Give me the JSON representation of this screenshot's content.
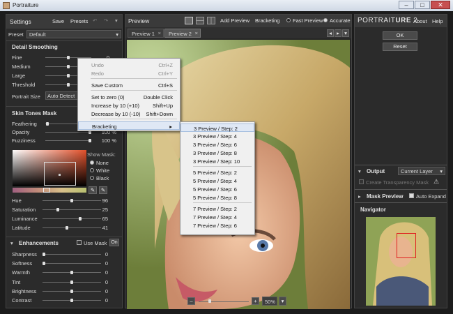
{
  "window": {
    "title": "Portraiture",
    "minimize": "–",
    "maximize": "□",
    "close": "✕"
  },
  "settings": {
    "title": "Settings",
    "save": "Save",
    "presets": "Presets",
    "preset_label": "Preset",
    "preset_value": "Default"
  },
  "detail": {
    "title": "Detail Smoothing",
    "items": [
      {
        "label": "Fine",
        "value": "0",
        "pos": 0.5
      },
      {
        "label": "Medium",
        "value": "",
        "pos": 0.5
      },
      {
        "label": "Large",
        "value": "",
        "pos": 0.5
      },
      {
        "label": "Threshold",
        "value": "",
        "pos": 0.5
      }
    ],
    "portrait_size_label": "Portrait Size",
    "portrait_size_value": "Auto Detect"
  },
  "skin": {
    "title": "Skin Tones Mask",
    "items": [
      {
        "label": "Feathering",
        "value": "",
        "pos": 0.02
      },
      {
        "label": "Opacity",
        "value": "100 %",
        "pos": 1
      },
      {
        "label": "Fuzziness",
        "value": "100 %",
        "pos": 1
      }
    ],
    "show_mask_label": "Show Mask:",
    "radios": [
      "None",
      "White",
      "Black"
    ],
    "hsl": [
      {
        "label": "Hue",
        "value": "96",
        "pos": 0.5
      },
      {
        "label": "Saturation",
        "value": "25",
        "pos": 0.25
      },
      {
        "label": "Luminance",
        "value": "65",
        "pos": 0.65
      },
      {
        "label": "Latitude",
        "value": "41",
        "pos": 0.41
      }
    ]
  },
  "enh": {
    "title": "Enhancements",
    "use_mask": "Use Mask",
    "on": "On",
    "items": [
      {
        "label": "Sharpness",
        "value": "0",
        "pos": 0
      },
      {
        "label": "Softness",
        "value": "0",
        "pos": 0
      },
      {
        "label": "Warmth",
        "value": "0",
        "pos": 0.5
      },
      {
        "label": "Tint",
        "value": "0",
        "pos": 0.5
      },
      {
        "label": "Brightness",
        "value": "0",
        "pos": 0.5
      },
      {
        "label": "Contrast",
        "value": "0",
        "pos": 0.5
      }
    ]
  },
  "preview": {
    "title": "Preview",
    "add_preview": "Add Preview",
    "bracketing": "Bracketing",
    "fast": "Fast Preview",
    "accurate": "Accurate",
    "tabs": [
      {
        "label": "Preview 1"
      },
      {
        "label": "Preview 2"
      }
    ],
    "zoom": "50%",
    "zoom_pos": 0.2,
    "minus": "–",
    "plus": "+"
  },
  "context_menu": {
    "items": [
      {
        "label": "Undo",
        "key": "Ctrl+Z",
        "disabled": true
      },
      {
        "label": "Redo",
        "key": "Ctrl+Y",
        "disabled": true
      },
      {
        "label": "Save Custom",
        "key": "Ctrl+S"
      },
      {
        "label": "Set to zero (0)",
        "key": "Double Click"
      },
      {
        "label": "Increase by 10 (+10)",
        "key": "Shift+Up"
      },
      {
        "label": "Decrease by 10 (-10)",
        "key": "Shift+Down"
      },
      {
        "label": "Bracketing",
        "key": "▸"
      }
    ]
  },
  "bracket_menu": {
    "items": [
      "3 Preview / Step: 2",
      "3 Preview / Step: 4",
      "3 Preview / Step: 6",
      "3 Preview / Step: 8",
      "3 Preview / Step: 10",
      "5 Preview / Step: 2",
      "5 Preview / Step: 4",
      "5 Preview / Step: 6",
      "5 Preview / Step: 8",
      "7 Preview / Step: 2",
      "7 Preview / Step: 4",
      "7 Preview / Step: 6"
    ]
  },
  "right": {
    "brand_a": "PORTRAIT",
    "brand_b": "URE",
    "brand_c": " 2",
    "about": "About",
    "help": "Help",
    "ok": "OK",
    "reset": "Reset",
    "output": "Output",
    "output_value": "Current Layer",
    "transparency": "Create Transparency Mask",
    "mask_preview": "Mask Preview",
    "auto_expand": "Auto Expand",
    "navigator": "Navigator"
  }
}
